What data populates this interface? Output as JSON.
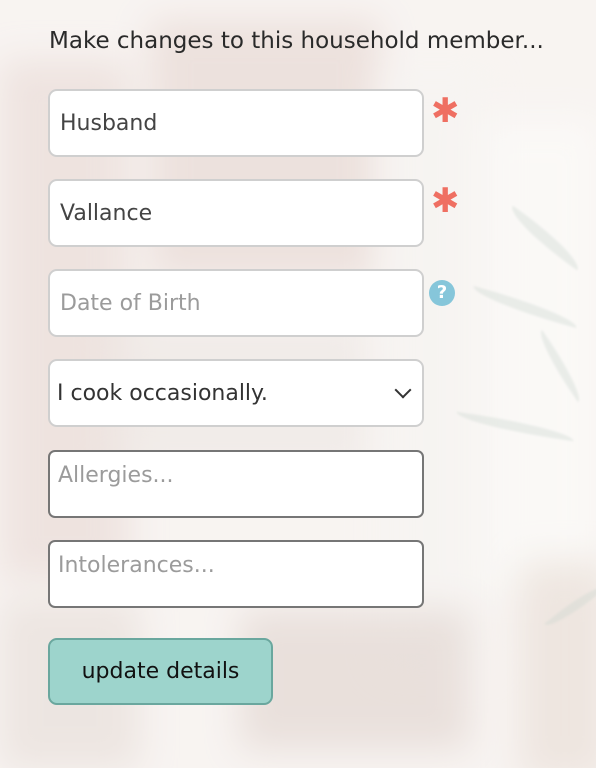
{
  "form": {
    "title": "Make changes to this household member...",
    "first_name": {
      "value": "Husband",
      "required_mark": "✱"
    },
    "last_name": {
      "value": "Vallance",
      "required_mark": "✱"
    },
    "dob": {
      "value": "",
      "placeholder": "Date of Birth",
      "help_mark": "?"
    },
    "cooking": {
      "selected": "I cook occasionally."
    },
    "allergies": {
      "placeholder": "Allergies..."
    },
    "intolerances": {
      "placeholder": "Intolerances..."
    },
    "submit_label": "update details"
  },
  "colors": {
    "required": "#ef6f62",
    "help": "#86c6da",
    "button": "#9dd4cc"
  },
  "icons": {
    "required": "asterisk-icon",
    "help": "question-circle-icon",
    "select": "chevron-down-icon"
  }
}
